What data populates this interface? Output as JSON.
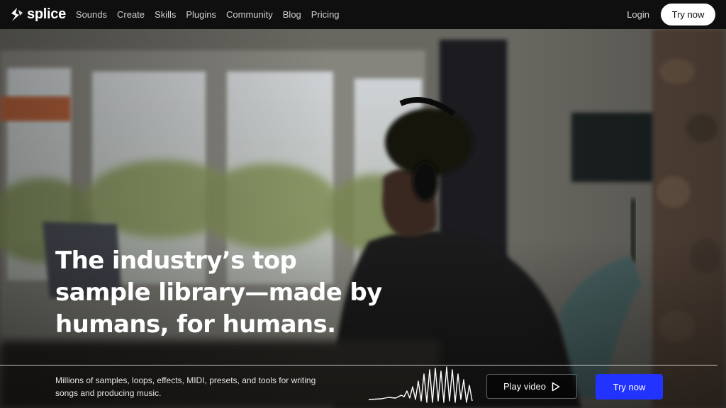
{
  "brand": {
    "name": "splice"
  },
  "nav": {
    "links": [
      "Sounds",
      "Create",
      "Skills",
      "Plugins",
      "Community",
      "Blog",
      "Pricing"
    ],
    "login_label": "Login",
    "cta_label": "Try now"
  },
  "hero": {
    "headline_lines": [
      "The industry’s top",
      "sample library—made by",
      "humans, for humans."
    ],
    "subtitle": "Millions of samples, loops, effects, MIDI, presets, and tools for writing songs and producing music.",
    "play_label": "Play video",
    "cta_label": "Try now"
  },
  "icons": {
    "logo": "splice-logo-icon",
    "play": "play-icon",
    "waveform": "waveform-icon"
  },
  "colors": {
    "nav_bg": "#0f0f0f",
    "primary_cta": "#2233ff",
    "white": "#ffffff"
  }
}
